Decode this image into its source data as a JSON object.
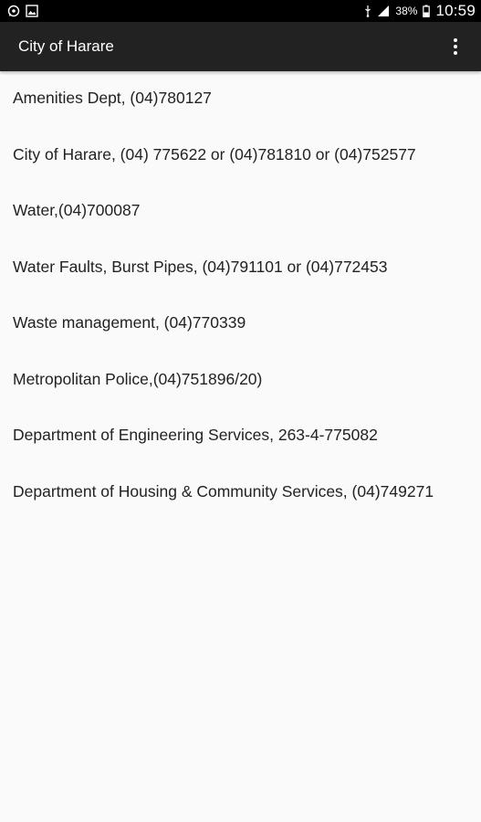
{
  "status_bar": {
    "left_icons": [
      "whatsapp-icon",
      "image-icon"
    ],
    "right_icons": [
      "usb-icon",
      "signal-icon",
      "battery-icon"
    ],
    "battery_percent": "38%",
    "time": "10:59"
  },
  "app_bar": {
    "title": "City of Harare",
    "overflow_icon": "more-vert-icon"
  },
  "contacts": [
    "Amenities Dept, (04)780127",
    "City of Harare, (04) 775622 or (04)781810 or (04)752577",
    "Water,(04)700087",
    "Water Faults, Burst Pipes, (04)791101 or (04)772453",
    "Waste management, (04)770339",
    "Metropolitan Police,(04)751896/20)",
    "Department of Engineering Services, 263-4-775082",
    "Department of Housing & Community Services, (04)749271"
  ]
}
